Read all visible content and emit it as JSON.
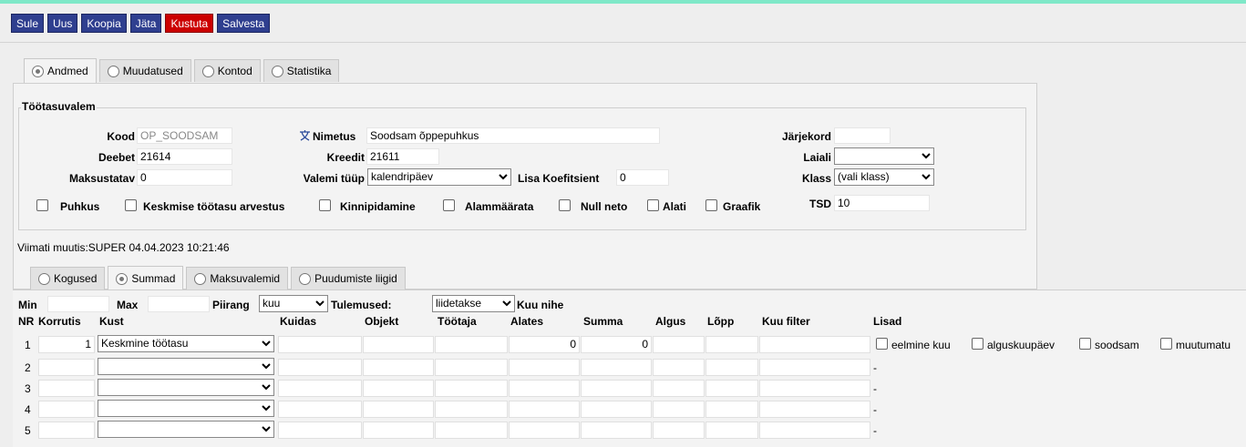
{
  "toolbar": {
    "close": "Sule",
    "new": "Uus",
    "copy": "Koopia",
    "leave": "Jäta",
    "delete": "Kustuta",
    "save": "Salvesta"
  },
  "top_tabs": [
    {
      "label": "Andmed"
    },
    {
      "label": "Muudatused"
    },
    {
      "label": "Kontod"
    },
    {
      "label": "Statistika"
    }
  ],
  "form": {
    "legend": "Töötasuvalem",
    "kood": {
      "label": "Kood",
      "value": "OP_SOODSAM"
    },
    "nimetus": {
      "label": "Nimetus",
      "value": "Soodsam õppepuhkus"
    },
    "jarjekord": {
      "label": "Järjekord",
      "value": ""
    },
    "deebet": {
      "label": "Deebet",
      "value": "21614"
    },
    "kreedit": {
      "label": "Kreedit",
      "value": "21611"
    },
    "laiali": {
      "label": "Laiali",
      "value": ""
    },
    "maksustatav": {
      "label": "Maksustatav",
      "value": "0"
    },
    "valemi_tyyp": {
      "label": "Valemi tüüp",
      "value": "kalendripäev"
    },
    "lisa_koef": {
      "label": "Lisa Koefitsient",
      "value": "0"
    },
    "klass": {
      "label": "Klass",
      "value": "(vali klass)"
    },
    "tsd": {
      "label": "TSD",
      "value": "10"
    },
    "checkboxes": {
      "puhkus": "Puhkus",
      "keskmise": "Keskmise töötasu arvestus",
      "kinnipidamine": "Kinnipidamine",
      "alammaarata": "Alammäärata",
      "null_neto": "Null neto",
      "alati": "Alati",
      "graafik": "Graafik"
    }
  },
  "modified": "Viimati muutis:SUPER 04.04.2023 10:21:46",
  "bottom_tabs": [
    {
      "label": "Kogused"
    },
    {
      "label": "Summad"
    },
    {
      "label": "Maksuvalemid"
    },
    {
      "label": "Puudumiste liigid"
    }
  ],
  "filters": {
    "min": "Min",
    "max": "Max",
    "piirang_label": "Piirang",
    "piirang_value": "kuu",
    "tulemused_label": "Tulemused:",
    "tulemused_value": "liidetakse",
    "kuu_nihe": "Kuu nihe"
  },
  "table": {
    "headers": {
      "nr": "NR",
      "korrutis": "Korrutis",
      "kust": "Kust",
      "kuidas": "Kuidas",
      "objekt": "Objekt",
      "tootaja": "Töötaja",
      "alates": "Alates",
      "summa": "Summa",
      "algus": "Algus",
      "lopp": "Lõpp",
      "kuu_filter": "Kuu filter",
      "lisad": "Lisad"
    },
    "rows": [
      {
        "nr": "1",
        "korrutis": "1",
        "kust": "Keskmine töötasu",
        "alates": "0",
        "summa": "0"
      },
      {
        "nr": "2",
        "korrutis": "",
        "kust": "",
        "alates": "",
        "summa": "",
        "lisad": "-"
      },
      {
        "nr": "3",
        "korrutis": "",
        "kust": "",
        "alates": "",
        "summa": "",
        "lisad": "-"
      },
      {
        "nr": "4",
        "korrutis": "",
        "kust": "",
        "alates": "",
        "summa": "",
        "lisad": "-"
      },
      {
        "nr": "5",
        "korrutis": "",
        "kust": "",
        "alates": "",
        "summa": "",
        "lisad": "-"
      }
    ],
    "row1_options": {
      "eelmine_kuu": "eelmine kuu",
      "alguskuupaev": "alguskuupäev",
      "soodsam": "soodsam",
      "muutumatu": "muutumatu"
    }
  }
}
